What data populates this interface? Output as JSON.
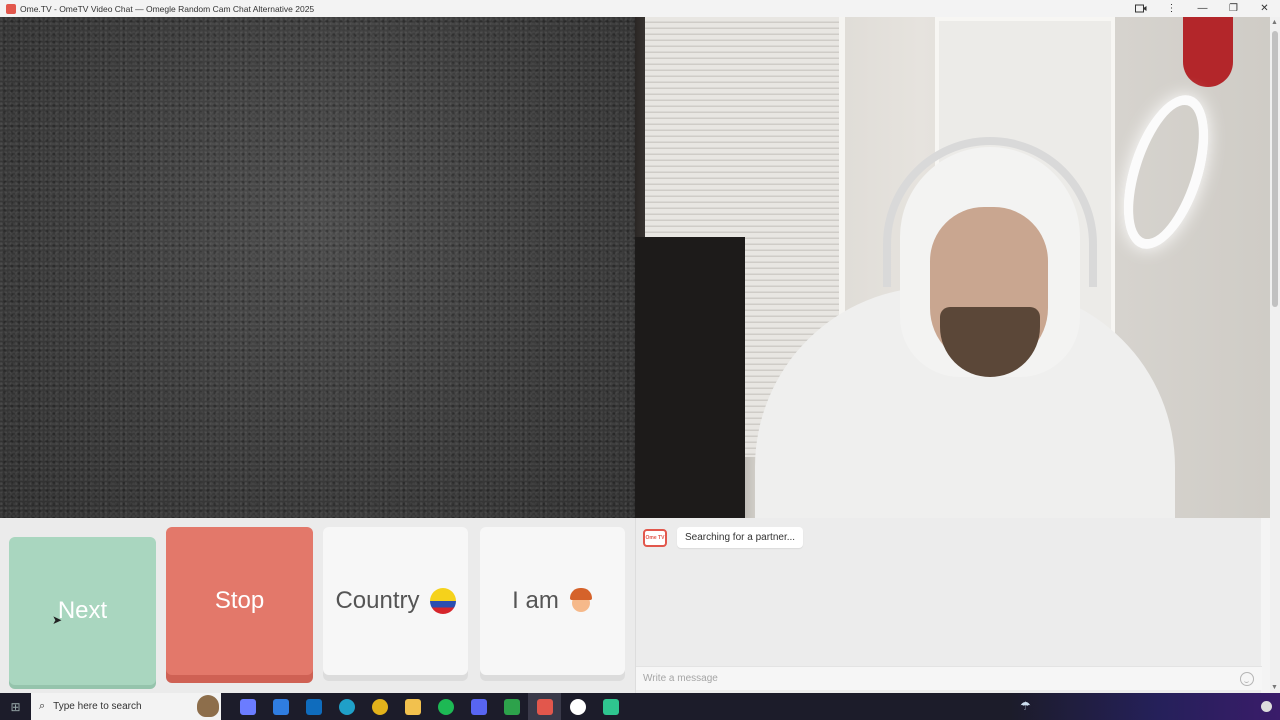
{
  "window": {
    "title": "Ome.TV - OmeTV Video Chat — Omegle Random Cam Chat Alternative 2025",
    "controls": {
      "camera_icon": "camera-icon",
      "menu": "⋮",
      "minimize": "—",
      "maximize": "❐",
      "close": "✕"
    }
  },
  "controls": {
    "next_label": "Next",
    "stop_label": "Stop",
    "country_label": "Country",
    "country_flag": "colombia-flag",
    "iam_label": "I am",
    "iam_avatar": "boy-avatar"
  },
  "chat": {
    "logo_text": "Ome TV",
    "status_message": "Searching for a partner...",
    "input_placeholder": "Write a message",
    "emoji_icon": "smiley-icon"
  },
  "taskbar": {
    "search_placeholder": "Type here to search",
    "apps": [
      {
        "name": "copilot",
        "color": "#6b7cff"
      },
      {
        "name": "store",
        "color": "#2f7de1"
      },
      {
        "name": "outlook",
        "color": "#0f6cbd"
      },
      {
        "name": "edge",
        "color": "#1fa0c8"
      },
      {
        "name": "chrome",
        "color": "#e2b21b"
      },
      {
        "name": "file-explorer",
        "color": "#f2c14e"
      },
      {
        "name": "spotify",
        "color": "#1db954"
      },
      {
        "name": "discord",
        "color": "#5865f2"
      },
      {
        "name": "xbox",
        "color": "#2da24b"
      },
      {
        "name": "ometv",
        "color": "#e2574c"
      },
      {
        "name": "obs",
        "color": "#ffffff"
      },
      {
        "name": "android-app",
        "color": "#2fc58f"
      }
    ]
  },
  "colors": {
    "next_button": "#a9d6bf",
    "stop_button": "#e3786a",
    "neutral_button": "#f7f7f7"
  }
}
